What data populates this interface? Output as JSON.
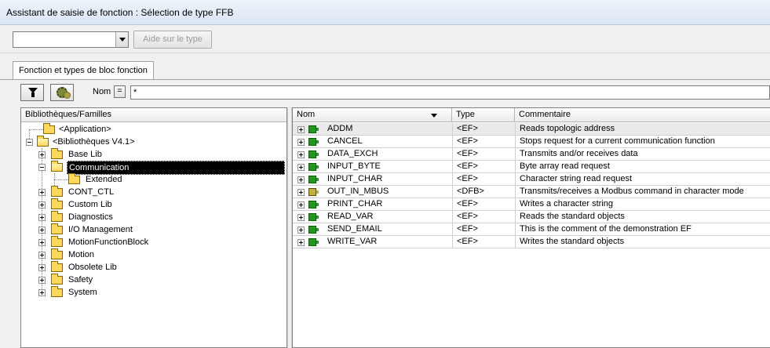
{
  "window": {
    "title": "Assistant de saisie de fonction : Sélection de type FFB"
  },
  "toolbar": {
    "combo_value": "",
    "help_button": "Aide sur le type"
  },
  "tabs": [
    {
      "label": "Fonction et types de bloc fonction"
    }
  ],
  "filter": {
    "filter_icon": "funnel-icon",
    "gear_icon": "gears-icon",
    "name_label": "Nom",
    "equals_label": "=",
    "name_value": "*"
  },
  "tree": {
    "header": "Bibliothèques/Familles",
    "items": [
      {
        "label": "<Application>"
      },
      {
        "label": "<Bibliothèques V4.1>"
      },
      {
        "label": "Base Lib"
      },
      {
        "label": "Communication"
      },
      {
        "label": "Extended"
      },
      {
        "label": "CONT_CTL"
      },
      {
        "label": "Custom Lib"
      },
      {
        "label": "Diagnostics"
      },
      {
        "label": "I/O Management"
      },
      {
        "label": "MotionFunctionBlock"
      },
      {
        "label": "Motion"
      },
      {
        "label": "Obsolete Lib"
      },
      {
        "label": "Safety"
      },
      {
        "label": "System"
      }
    ]
  },
  "list": {
    "columns": {
      "name": "Nom",
      "type": "Type",
      "comment": "Commentaire"
    },
    "rows": [
      {
        "name": "ADDM",
        "type": "<EF>",
        "comment": "Reads topologic address"
      },
      {
        "name": "CANCEL",
        "type": "<EF>",
        "comment": "Stops request for a current communication function"
      },
      {
        "name": "DATA_EXCH",
        "type": "<EF>",
        "comment": "Transmits and/or receives data"
      },
      {
        "name": "INPUT_BYTE",
        "type": "<EF>",
        "comment": "Byte array read request"
      },
      {
        "name": "INPUT_CHAR",
        "type": "<EF>",
        "comment": "Character string read request"
      },
      {
        "name": "OUT_IN_MBUS",
        "type": "<DFB>",
        "comment": "Transmits/receives a Modbus command in character mode"
      },
      {
        "name": "PRINT_CHAR",
        "type": "<EF>",
        "comment": "Writes a character string"
      },
      {
        "name": "READ_VAR",
        "type": "<EF>",
        "comment": "Reads the standard objects"
      },
      {
        "name": "SEND_EMAIL",
        "type": "<EF>",
        "comment": "This is the comment of the demonstration EF"
      },
      {
        "name": "WRITE_VAR",
        "type": "<EF>",
        "comment": "Writes the standard objects"
      }
    ]
  }
}
